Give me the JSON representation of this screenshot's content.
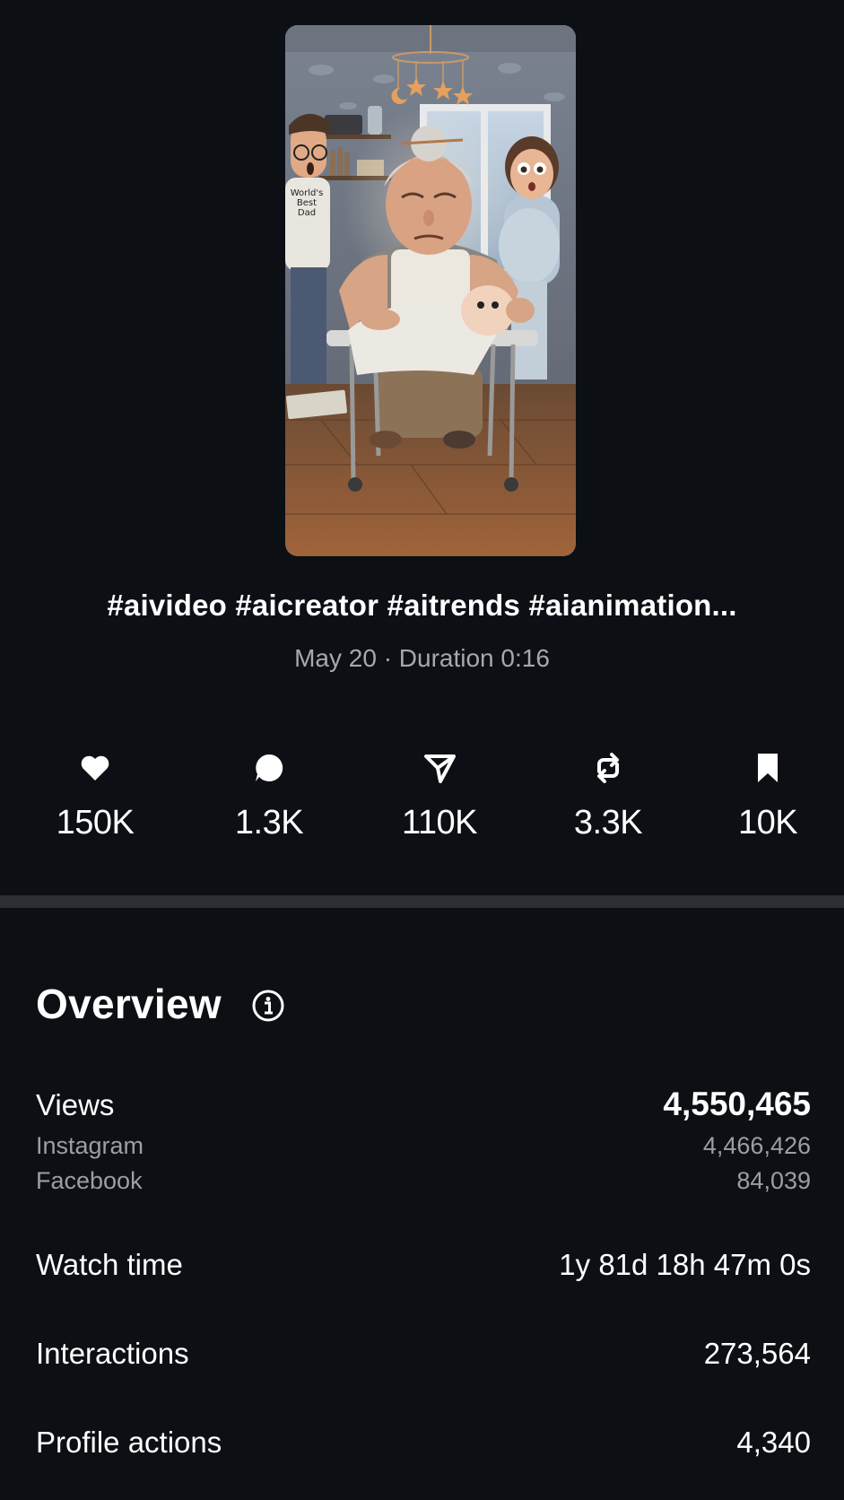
{
  "post": {
    "caption": "#aivideo #aicreator #aitrends #aianimation...",
    "meta": "May 20 · Duration 0:16",
    "thumbnail_tshirt_text": [
      "World's",
      "Best",
      "Dad"
    ]
  },
  "stats": [
    {
      "icon": "heart-icon",
      "value": "150K"
    },
    {
      "icon": "comment-icon",
      "value": "1.3K"
    },
    {
      "icon": "send-icon",
      "value": "110K"
    },
    {
      "icon": "repost-icon",
      "value": "3.3K"
    },
    {
      "icon": "bookmark-icon",
      "value": "10K"
    }
  ],
  "overview": {
    "title": "Overview",
    "info_icon": "info-icon",
    "views": {
      "label": "Views",
      "value": "4,550,465",
      "instagram_label": "Instagram",
      "instagram_value": "4,466,426",
      "facebook_label": "Facebook",
      "facebook_value": "84,039"
    },
    "watch_time": {
      "label": "Watch time",
      "value": "1y 81d 18h 47m 0s"
    },
    "interactions": {
      "label": "Interactions",
      "value": "273,564"
    },
    "profile_actions": {
      "label": "Profile actions",
      "value": "4,340"
    }
  },
  "colors": {
    "background": "#0c0f14",
    "divider": "#2b2e33",
    "secondary_text": "#a6a8ad"
  }
}
